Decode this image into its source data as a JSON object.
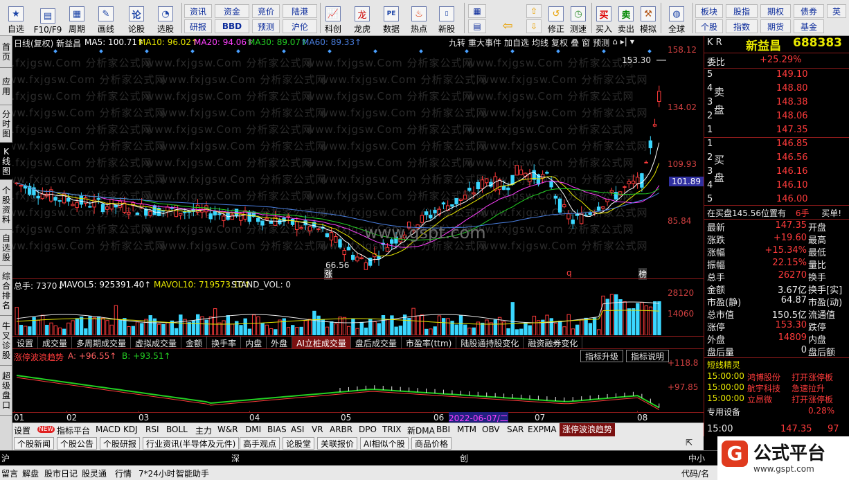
{
  "toolbar": {
    "buttons": [
      {
        "label": "自选",
        "icon": "star-icon"
      },
      {
        "label": "F10/F9",
        "icon": "f10-icon"
      },
      {
        "label": "周期",
        "icon": "calendar-icon"
      },
      {
        "label": "画线",
        "icon": "pencil-icon"
      },
      {
        "label": "论股",
        "icon": "chat-icon"
      },
      {
        "label": "选股",
        "icon": "stock-pick-icon"
      }
    ],
    "grid_buttons": [
      "资讯",
      "资金",
      "竞价",
      "陆港",
      "研报",
      "BBD",
      "预测",
      "沪伦"
    ],
    "buttons2": [
      {
        "label": "科创",
        "icon": "chart-icon"
      },
      {
        "label": "龙虎",
        "icon": "dragon-icon"
      },
      {
        "label": "数据",
        "icon": "pe-icon"
      },
      {
        "label": "热点",
        "icon": "fire-icon"
      },
      {
        "label": "新股",
        "icon": "new-stock-icon"
      }
    ],
    "buttons3": [
      {
        "label": "修正",
        "icon": "undo-icon"
      },
      {
        "label": "测速",
        "icon": "speed-icon"
      },
      {
        "label": "买入",
        "icon": "buy-icon",
        "glyph": "买"
      },
      {
        "label": "卖出",
        "icon": "sell-icon",
        "glyph": "卖"
      },
      {
        "label": "模拟",
        "icon": "hammer-icon"
      },
      {
        "label": "全球",
        "icon": "globe-icon"
      }
    ],
    "grid_buttons2": [
      "板块",
      "股指",
      "期权",
      "债券",
      "英",
      "个股",
      "指数",
      "期货",
      "基金"
    ]
  },
  "left_tabs": [
    "首页",
    "应用",
    "分时图",
    "K线图",
    "个股资料",
    "自选股",
    "综合排名",
    "牛叉诊股",
    "超级盘口"
  ],
  "chart": {
    "header": {
      "title": "日线(复权) 新益昌",
      "ma5": "MA5: 100.71↑",
      "ma10": "MA10: 96.02↑",
      "ma20": "MA20: 94.06↑",
      "ma30": "MA30: 89.07↑",
      "ma60": "MA60: 89.33↑"
    },
    "menu": [
      "九转",
      "重大事件",
      "加自选",
      "均线",
      "复权",
      "叠",
      "窗",
      "预测"
    ],
    "y_labels": [
      "158.12",
      "134.02",
      "109.93",
      "101.89",
      "85.84"
    ],
    "annotations": {
      "high": "153.30",
      "low": "66.56",
      "mark1": "涨",
      "mark2": "q",
      "mark3": "榜"
    },
    "watermark_text": "www.fxjgsw.Com 分析家公式网",
    "center_watermark": "www.gspt.com",
    "volume": {
      "header_total": "总手: 7370↓",
      "mavol5": "MAVOL5: 925391.40↑",
      "mavol10": "MAVOL10: 719573.10↑",
      "stand": "STAND_VOL: 0",
      "y_labels": [
        "28120",
        "14060"
      ]
    },
    "sub_tabs": [
      "设置",
      "成交量",
      "多周期成交量",
      "虚拟成交量",
      "金额",
      "换手率",
      "内盘",
      "外盘",
      "AI立桩成交量",
      "盘后成交量",
      "市盈率(ttm)",
      "陆股通持股变化",
      "融资融券变化"
    ],
    "active_sub_tab": "AI立桩成交量",
    "indicator": {
      "name": "涨停波浪趋势",
      "a": "A: +96.55↑",
      "b": "B: +93.51↑",
      "buttons": [
        "指标升级",
        "指标说明"
      ],
      "y_labels": [
        "+118.8",
        "+97.85"
      ]
    },
    "x_labels": [
      "01",
      "02",
      "03",
      "04",
      "05",
      "06",
      "07",
      "08"
    ],
    "cursor_date": "2022-06-07/二"
  },
  "indicator_tabs": [
    "设置",
    "NEW",
    "指标平台",
    "MACD",
    "KDJ",
    "RSI",
    "BOLL",
    "主力",
    "W&R",
    "DMI",
    "BIAS",
    "ASI",
    "VR",
    "ARBR",
    "DPO",
    "TRIX",
    "新DMA",
    "BBI",
    "MTM",
    "OBV",
    "SAR",
    "EXPMA",
    "涨停波浪趋势"
  ],
  "news_tabs": [
    "个股新闻",
    "个股公告",
    "个股研报",
    "行业资讯(半导体及元件)",
    "高手观点",
    "论股堂",
    "关联报价",
    "AI相似个股",
    "商品价格"
  ],
  "right": {
    "market": "K R",
    "name": "新益昌",
    "code": "688383",
    "weibi_label": "委比",
    "weibi": "+25.29%",
    "sell_label": "卖盘",
    "buy_label": "买盘",
    "asks": [
      {
        "n": "5",
        "p": "149.10"
      },
      {
        "n": "4",
        "p": "148.80"
      },
      {
        "n": "3",
        "p": "148.38"
      },
      {
        "n": "2",
        "p": "148.06"
      },
      {
        "n": "1",
        "p": "147.35"
      }
    ],
    "bids": [
      {
        "n": "1",
        "p": "146.85"
      },
      {
        "n": "2",
        "p": "146.56"
      },
      {
        "n": "3",
        "p": "146.16"
      },
      {
        "n": "4",
        "p": "146.10"
      },
      {
        "n": "5",
        "p": "146.00"
      }
    ],
    "queue_text": "在买盘145.56位置有",
    "queue_count": "6手",
    "queue_action": "买单!",
    "stats": [
      {
        "l": "最新",
        "v": "147.35",
        "r": "开盘"
      },
      {
        "l": "涨跌",
        "v": "+19.60",
        "r": "最高"
      },
      {
        "l": "涨幅",
        "v": "+15.34%",
        "r": "最低"
      },
      {
        "l": "振幅",
        "v": "22.15%",
        "r": "量比"
      },
      {
        "l": "总手",
        "v": "26270",
        "r": "换手"
      },
      {
        "l": "金额",
        "v": "3.67亿",
        "r": "换手[实]"
      },
      {
        "l": "市盈(静)",
        "v": "64.87",
        "r": "市盈(动)"
      },
      {
        "l": "总市值",
        "v": "150.5亿",
        "r": "流通值"
      },
      {
        "l": "涨停",
        "v": "153.30",
        "r": "跌停"
      },
      {
        "l": "外盘",
        "v": "14809",
        "r": "内盘"
      },
      {
        "l": "盘后量",
        "v": "0",
        "r": "盘后额"
      }
    ],
    "section_title": "短线精灵",
    "events": [
      {
        "t": "15:00:00",
        "s": "鸿博股份",
        "e": "打开涨停板"
      },
      {
        "t": "15:00:00",
        "s": "航宇科技",
        "e": "急速拉升"
      },
      {
        "t": "15:00:00",
        "s": "立昂微",
        "e": "打开涨停板"
      }
    ],
    "device_label": "专用设备",
    "device_pct": "0.28%",
    "tick_time": "15:00",
    "tick_price": "147.35",
    "tick_vol": "97"
  },
  "status": {
    "sh": "沪",
    "sz": "深",
    "cy": "创",
    "zx": "中小"
  },
  "bottom": [
    "留言",
    "解盘",
    "股市日记",
    "股灵通",
    "行情",
    "7*24小时",
    "智能助手"
  ],
  "bottom_right": "代码/名",
  "logo": {
    "text": "公式平台",
    "url": "www.gspt.com"
  },
  "colors": {
    "up": "#ff3b3b",
    "down": "#3ad7ff",
    "ma5": "#ffffff",
    "ma10": "#e8e800",
    "ma20": "#ff40ff",
    "ma30": "#23d023",
    "ma60": "#4a7fe0"
  }
}
